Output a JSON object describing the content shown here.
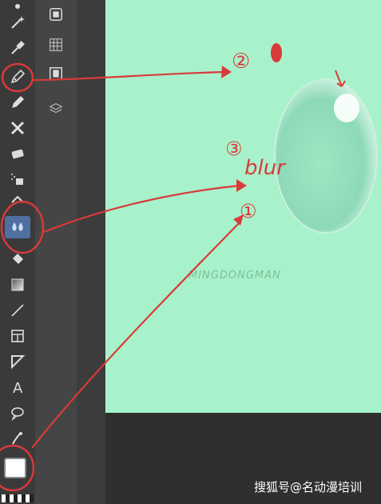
{
  "annotations": {
    "num2": "②",
    "num3": "③",
    "num1": "①",
    "blur": "blur"
  },
  "watermark": "搜狐号@名动漫培训",
  "logo": "名动漫",
  "logo_sub": "MINGDONGMAN",
  "colors": {
    "canvas": "#a8f2cb",
    "annotation": "#d93a3a",
    "active_tool": "#4f6fa0"
  },
  "tools": [
    "magic-wand-icon",
    "eyedropper-icon",
    "pen-icon",
    "pencil-icon",
    "brush-icon",
    "eraser-icon",
    "airbrush-icon",
    "fill-icon",
    "blend-icon",
    "bucket-icon",
    "gradient-icon",
    "line-icon",
    "frame-icon",
    "ruler-icon",
    "text-icon",
    "speech-balloon-icon",
    "correction-icon",
    "color-swatch"
  ],
  "subtools": [
    "layer-icon",
    "grid-icon",
    "film-icon",
    "stack-icon"
  ]
}
